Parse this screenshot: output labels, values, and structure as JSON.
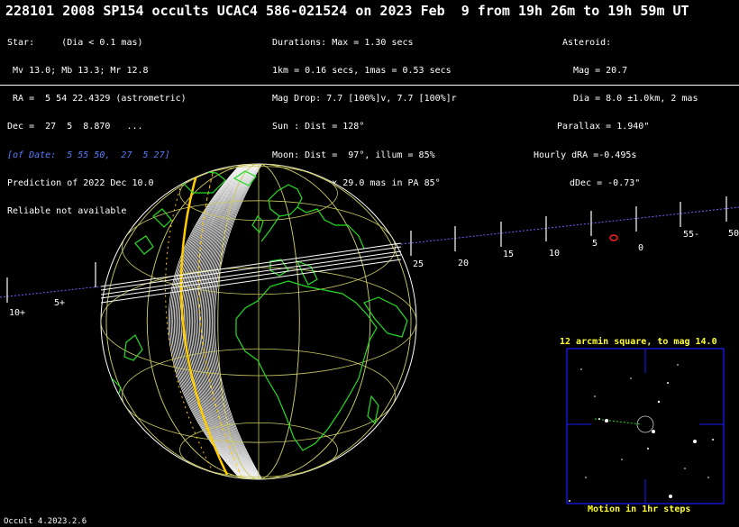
{
  "title": "228101 2008 SP154 occults UCAC4 586-021524 on 2023 Feb  9 from 19h 26m to 19h 59m UT",
  "star": {
    "line1": "Star:     (Dia < 0.1 mas)",
    "line2": " Mv 13.0; Mb 13.3; Mr 12.8",
    "line3": " RA =  5 54 22.4329 (astrometric)",
    "line4": "Dec =  27  5  8.870   ...",
    "line5": "[of Date:  5 55 50,  27  5 27]",
    "line6": "Prediction of 2022 Dec 10.0",
    "line7": "Reliable not available"
  },
  "event": {
    "line1": "Durations: Max = 1.30 secs",
    "line2": "1km = 0.16 secs, 1mas = 0.53 secs",
    "line3": "Mag Drop: 7.7 [100%]v, 7.7 [100%]r",
    "line4": "Sun : Dist = 128°",
    "line5": "Moon: Dist =  97°, illum = 85%",
    "line6": "Error 40.0 x 29.0 mas in PA 85°"
  },
  "asteroid": {
    "line1": "Asteroid:",
    "line2": "Mag = 20.7",
    "line3": "Dia = 8.0 ±1.0km, 2 mas",
    "line4": "Parallax = 1.940\"",
    "line5": "Hourly dRA =-0.495s",
    "line6": "dDec = -0.73\""
  },
  "colors": {
    "coastline": "#22dd22",
    "grid": "#c8c860",
    "terminator": "#ffcc00",
    "path_ticks": "#7a5cff",
    "asteroid_marker": "#ff2020",
    "finder_frame": "#1a1aff",
    "finder_text": "#ffff33"
  },
  "path_ticks": [
    {
      "label": "10+"
    },
    {
      "label": "5+"
    },
    {
      "label": "25"
    },
    {
      "label": "20"
    },
    {
      "label": "15"
    },
    {
      "label": "10"
    },
    {
      "label": "5"
    },
    {
      "label": "0"
    },
    {
      "label": "55-"
    },
    {
      "label": "50"
    }
  ],
  "finder": {
    "title": "12 arcmin square, to mag 14.0",
    "footer": "Motion in 1hr steps"
  },
  "version": "Occult 4.2023.2.6"
}
